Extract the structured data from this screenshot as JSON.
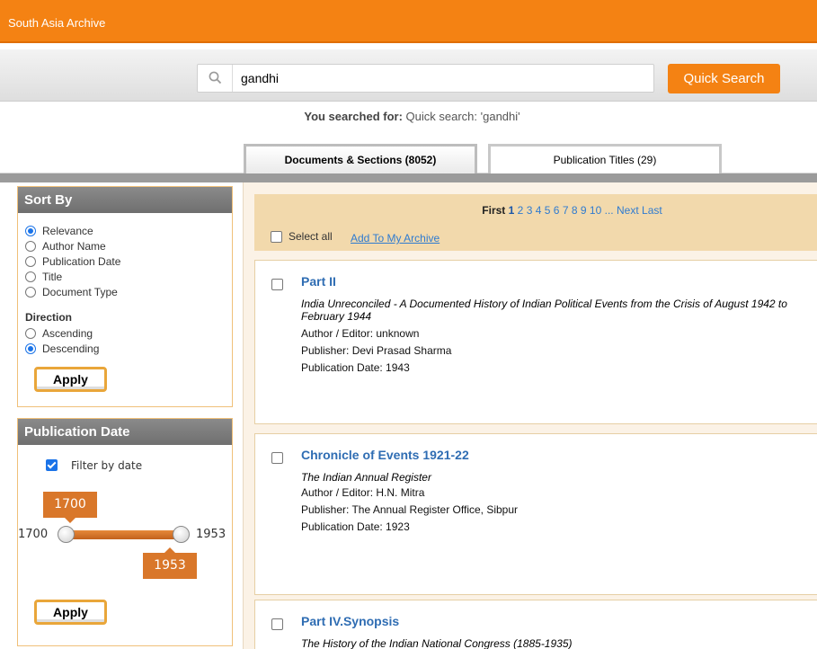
{
  "header": {
    "brand": "South Asia Archive"
  },
  "search": {
    "query": "gandhi",
    "button_label": "Quick Search"
  },
  "searched_for": {
    "label": "You searched for:",
    "value": "Quick search: 'gandhi'"
  },
  "tabs": [
    {
      "label": "Documents & Sections (8052)"
    },
    {
      "label": "Publication Titles (29)"
    }
  ],
  "sort": {
    "title": "Sort By",
    "options": [
      "Relevance",
      "Author Name",
      "Publication Date",
      "Title",
      "Document Type"
    ],
    "selected": "Relevance",
    "direction_label": "Direction",
    "directions": [
      "Ascending",
      "Descending"
    ],
    "direction_selected": "Descending",
    "apply_label": "Apply"
  },
  "pubdate": {
    "title": "Publication Date",
    "filter_label": "Filter by date",
    "filter_checked": true,
    "min": "1700",
    "max": "1953",
    "low_value": "1700",
    "high_value": "1953",
    "apply_label": "Apply"
  },
  "pager": {
    "first": "First",
    "current": "1",
    "pages": [
      "2",
      "3",
      "4",
      "5",
      "6",
      "7",
      "8",
      "9",
      "10"
    ],
    "ellipsis": "...",
    "next": "Next",
    "last": "Last",
    "select_all": "Select all",
    "add_to_archive": "Add To My Archive"
  },
  "results": [
    {
      "title": "Part II",
      "publication": "India Unreconciled - A Documented History of Indian Political Events from the Crisis of August 1942 to February 1944",
      "author": "Author / Editor: unknown",
      "publisher": "Publisher: Devi Prasad Sharma",
      "date": "Publication Date: 1943"
    },
    {
      "title": "Chronicle of Events 1921-22",
      "publication": "The Indian Annual Register",
      "author": "Author / Editor: H.N. Mitra",
      "publisher": "Publisher: The Annual Register Office, Sibpur",
      "date": "Publication Date: 1923"
    },
    {
      "title": "Part IV.Synopsis",
      "publication": "The History of the Indian National Congress (1885-1935)"
    }
  ]
}
